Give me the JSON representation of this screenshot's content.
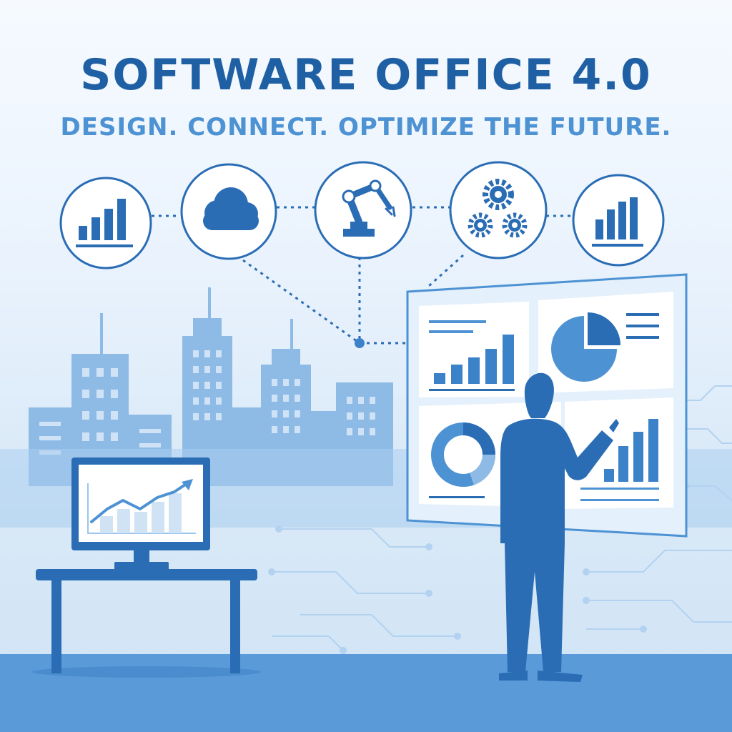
{
  "title": "SOFTWARE OFFICE 4.0",
  "subtitle": "DESIGN. CONNECT. OPTIMIZE THE FUTURE.",
  "colors": {
    "primary": "#2a6db5",
    "dark": "#1f5fa4",
    "accent": "#4d92d3",
    "light": "#9cc5ec",
    "background": "#eaf3fd"
  },
  "icons": [
    "bar-chart-icon",
    "cloud-icon",
    "robot-arm-icon",
    "gears-icon",
    "bar-chart-icon"
  ]
}
